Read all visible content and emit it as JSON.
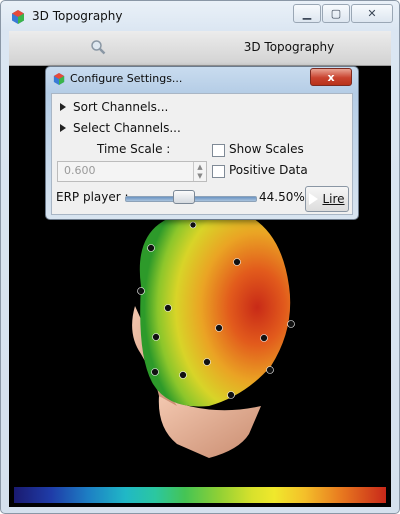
{
  "window": {
    "title": "3D Topography"
  },
  "toolbar": {
    "search_icon": "magnifier-icon",
    "view_title": "3D Topography"
  },
  "dialog": {
    "title": "Configure Settings...",
    "close_label": "x",
    "tree": [
      {
        "label": "Sort Channels..."
      },
      {
        "label": "Select Channels..."
      }
    ],
    "time_scale_label": "Time Scale :",
    "time_scale_value": "0.600",
    "show_scales_label": "Show Scales",
    "positive_data_label": "Positive Data",
    "erp_player_label": "ERP player :",
    "erp_percent": "44.50%",
    "erp_position": 44.5,
    "play_label": "Lire"
  },
  "colorbar": {
    "colors": [
      "#1a1a70",
      "#1d7fc4",
      "#2bc7a0",
      "#8fd035",
      "#f0e82c",
      "#e8791f",
      "#c8281a"
    ]
  }
}
